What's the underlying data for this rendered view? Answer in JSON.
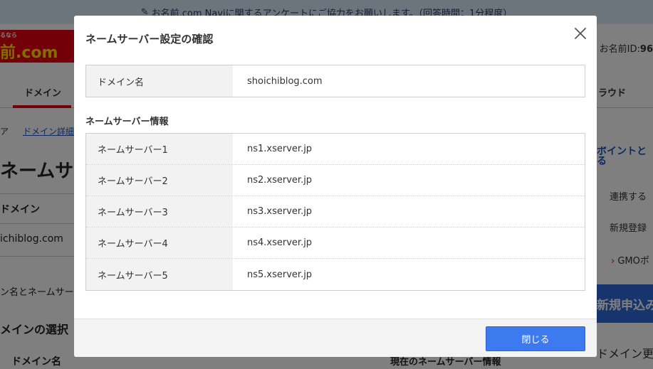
{
  "background": {
    "notice": "お名前.com Naviに関するアンケートにご協力をお願いします。（回答時間：1分程度）",
    "logo_text": "前.com",
    "logo_small": "るなら",
    "user_id_label": "お名前ID:",
    "user_id_value": "96",
    "nav_items": [
      "ドメイン",
      "ラウド"
    ],
    "breadcrumb_sep": "ア",
    "breadcrumb_link": "ドメイン詳細",
    "page_title": "ネームサーバ",
    "domain_heading": "ドメイン",
    "domain_value": "ichiblog.com",
    "desc_text": "ン名とネームサー",
    "select_heading": "メインの選択",
    "col_domain": "ドメイン名",
    "col_current_ns": "現在のネームサーバー情報",
    "side_points": "ポイントと\nる",
    "side_link1": "連携する",
    "side_link2": "新規登録",
    "side_gmo": "GMOポ",
    "side_blue_btn": "新規申込み",
    "side_domain_more": "ドメイン更"
  },
  "modal": {
    "title": "ネームサーバー設定の確認",
    "close_icon": "close-icon",
    "domain_row": {
      "label": "ドメイン名",
      "value": "shoichiblog.com"
    },
    "section_title": "ネームサーバー情報",
    "nameservers": [
      {
        "label": "ネームサーバー1",
        "value": "ns1.xserver.jp"
      },
      {
        "label": "ネームサーバー2",
        "value": "ns2.xserver.jp"
      },
      {
        "label": "ネームサーバー3",
        "value": "ns3.xserver.jp"
      },
      {
        "label": "ネームサーバー4",
        "value": "ns4.xserver.jp"
      },
      {
        "label": "ネームサーバー5",
        "value": "ns5.xserver.jp"
      }
    ],
    "close_button": "閉じる"
  },
  "colors": {
    "overlay": "rgba(0,0,0,0.5)",
    "brand_red": "#e60012",
    "primary_button": "#3d7af0",
    "key_cell_bg": "#f2f2f2"
  }
}
